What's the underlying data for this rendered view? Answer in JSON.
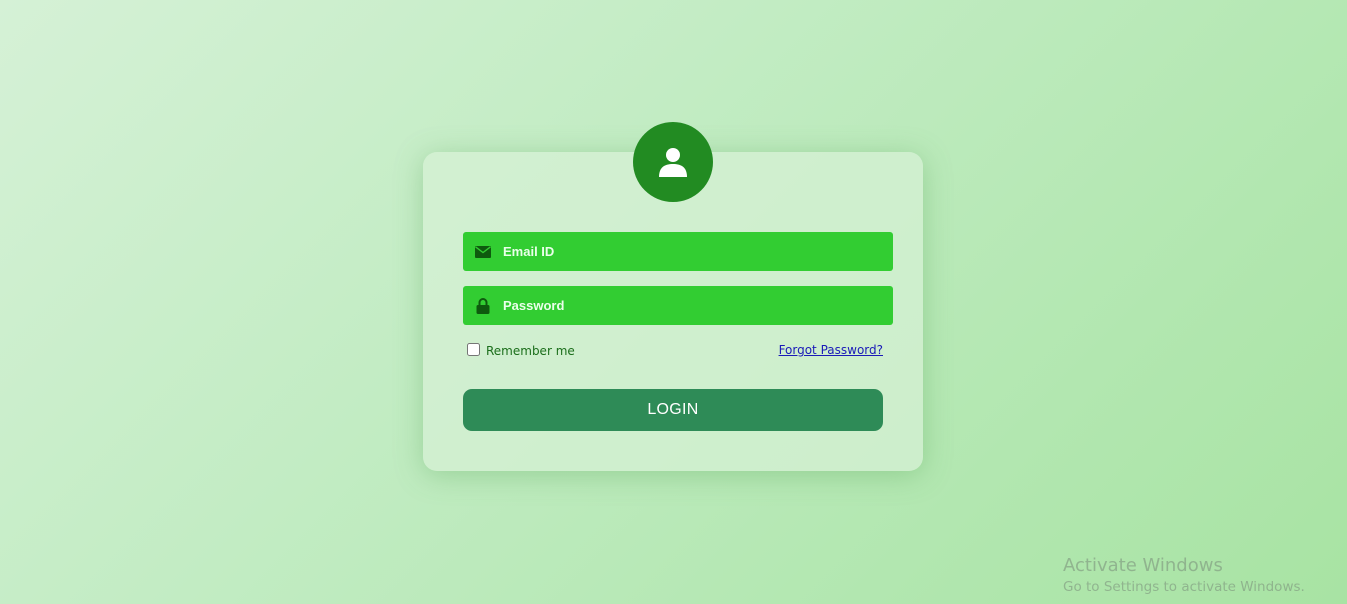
{
  "login": {
    "email_placeholder": "Email ID",
    "password_placeholder": "Password",
    "remember_label": "Remember me",
    "remember_checked": false,
    "forgot_link": "Forgot Password?",
    "login_button": "LOGIN"
  },
  "icons": {
    "avatar": "user-icon",
    "email": "envelope-icon",
    "password": "lock-icon"
  },
  "colors": {
    "avatar_bg": "#228b22",
    "field_bg": "#32cd32",
    "button_bg": "#2e8b57",
    "icon_dark": "#0e5a0e",
    "link": "#1a1ab8"
  },
  "watermark": {
    "title": "Activate Windows",
    "subtitle": "Go to Settings to activate Windows."
  }
}
